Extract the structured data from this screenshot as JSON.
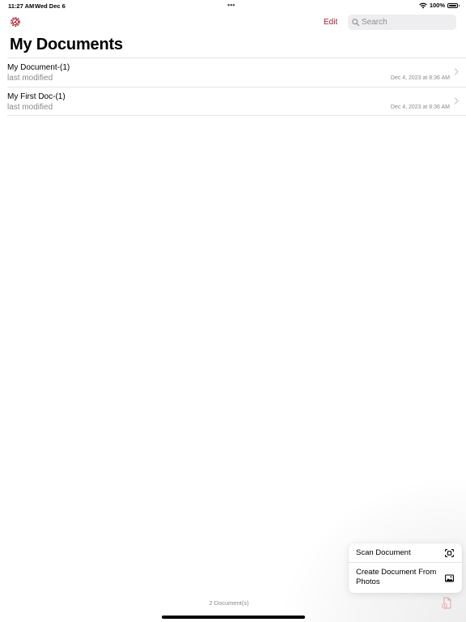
{
  "status_bar": {
    "time": "11:27 AM",
    "date": "Wed Dec 6",
    "dots": "•••",
    "battery": "100%"
  },
  "nav": {
    "edit_label": "Edit",
    "search_placeholder": "Search"
  },
  "page": {
    "title": "My Documents"
  },
  "documents": [
    {
      "name": "My Document-(1)",
      "subtitle": "last modified",
      "date": "Dec 4, 2023 at 8:36 AM"
    },
    {
      "name": "My First Doc-(1)",
      "subtitle": "last modified",
      "date": "Dec 4, 2023 at 8:36 AM"
    }
  ],
  "menu": {
    "items": [
      {
        "label": "Scan Document",
        "icon": "scan-viewfinder-icon"
      },
      {
        "label": "Create Document From Photos",
        "icon": "photo-icon"
      }
    ]
  },
  "footer": {
    "doc_count": "2 Document(s)"
  },
  "colors": {
    "accent": "#a1182b",
    "secondary_text": "#8a8a8e",
    "separator": "#e4e4e6"
  },
  "icons": {
    "settings": "gear-icon",
    "search": "search-icon",
    "chevron": "chevron-right-icon",
    "new_document": "new-document-icon",
    "wifi": "wifi-icon",
    "battery": "battery-icon"
  }
}
